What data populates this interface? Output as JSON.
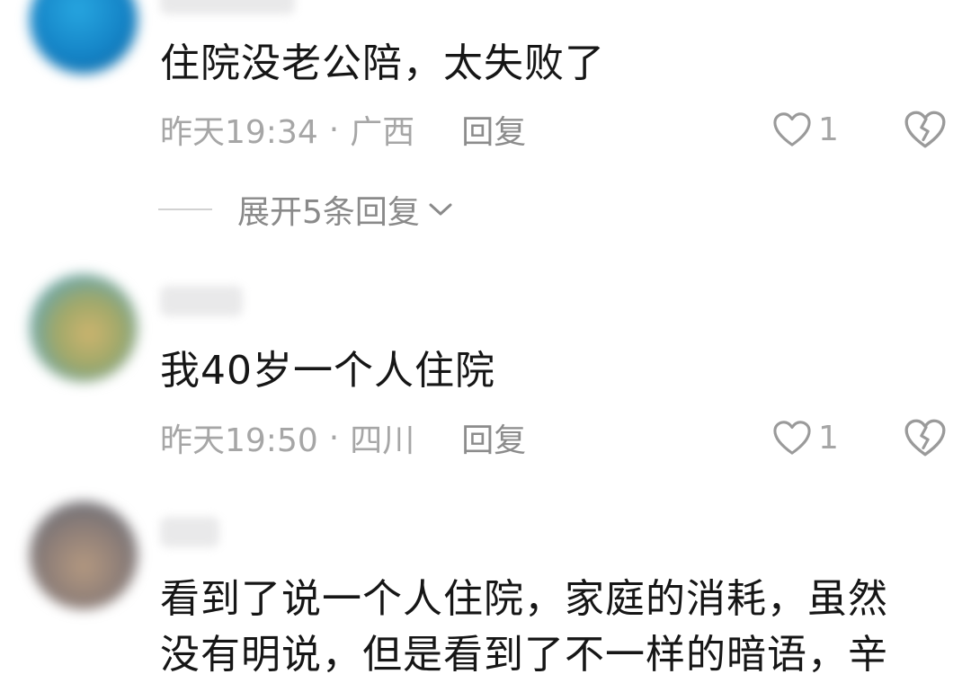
{
  "comments": [
    {
      "text": "住院没老公陪，太失败了",
      "time": "昨天19:34",
      "separator": "·",
      "location": "广西",
      "reply_label": "回复",
      "likes": "1",
      "expand_label": "展开5条回复"
    },
    {
      "text": "我40岁一个人住院",
      "time": "昨天19:50",
      "separator": "·",
      "location": "四川",
      "reply_label": "回复",
      "likes": "1"
    },
    {
      "text": "看到了说一个人住院，家庭的消耗，虽然\n没有明说，但是看到了不一样的暗语，辛"
    }
  ],
  "icons": {
    "like": "heart-outline-icon",
    "dislike": "broken-heart-icon",
    "expand": "chevron-down-icon"
  },
  "colors": {
    "text": "#161616",
    "meta": "#a6a6a6",
    "icon": "#9a9a9a"
  }
}
